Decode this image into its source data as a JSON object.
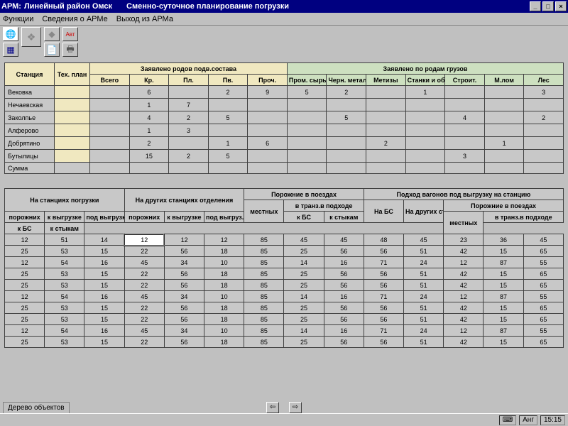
{
  "titlebar": {
    "app": "АРМ:",
    "region": "Линейный район Омск",
    "subtitle": "Сменно-суточное планирование погрузки"
  },
  "menu": {
    "functions": "Функции",
    "about": "Сведения о АРМе",
    "exit": "Выход из АРМа"
  },
  "table1": {
    "h_station": "Станция",
    "h_plan": "Тех. план",
    "h_declared_types": "Заявлено родов подв.состава",
    "h_declared_cargo": "Заявлено по родам грузов",
    "h_total": "Всего",
    "h_kr": "Кр.",
    "h_pl": "Пл.",
    "h_pv": "Пв.",
    "h_other": "Проч.",
    "h_prom": "Пром. сырье",
    "h_chern": "Черн. металл.",
    "h_metiz": "Метизы",
    "h_stanki": "Станки и оборуд.",
    "h_stroit": "Строит.",
    "h_mlom": "М.лом",
    "h_les": "Лес",
    "rows": [
      {
        "st": "Вековка",
        "kr": "6",
        "pv": "2",
        "proch": "9",
        "prom": "5",
        "chern": "2",
        "stanki": "1",
        "les": "3"
      },
      {
        "st": "Нечаевская",
        "kr": "1",
        "pl": "7"
      },
      {
        "st": "Заколпье",
        "kr": "4",
        "pl": "2",
        "pv": "5",
        "chern": "5",
        "stroit": "4",
        "les": "2"
      },
      {
        "st": "Алферово",
        "kr": "1",
        "pl": "3"
      },
      {
        "st": "Добрятино",
        "kr": "2",
        "pv": "1",
        "proch": "6",
        "metiz": "2",
        "mlom": "1"
      },
      {
        "st": "Бутылицы",
        "kr": "15",
        "pl": "2",
        "pv": "5",
        "stroit": "3"
      }
    ],
    "sum_label": "Сумма"
  },
  "table2": {
    "h_loading": "На станциях погрузки",
    "h_other_st": "На других станциях отделения",
    "h_empty_trains": "Порожние в поездах",
    "h_approach": "Подход вагонов под выгрузку на станцию",
    "h_empty": "порожних",
    "h_unload": "к выгрузке",
    "h_under_unload": "под выгрузкой",
    "h_under_unload2": "под выгруз.",
    "h_local": "местных",
    "h_transit": "в транз.в подходе",
    "h_kbs": "к БС",
    "h_kstykam": "к стыкам",
    "h_nabs": "На БС",
    "h_other_nod": "На других ст. НОД",
    "h_empty2": "Порожние в поездах",
    "h_transit2": "в транз.в подходе",
    "rows": [
      [
        12,
        51,
        14,
        12,
        12,
        12,
        85,
        45,
        45,
        48,
        45,
        23,
        36,
        45
      ],
      [
        25,
        53,
        15,
        22,
        56,
        18,
        85,
        25,
        56,
        56,
        51,
        42,
        15,
        65
      ],
      [
        12,
        54,
        16,
        45,
        34,
        10,
        85,
        14,
        16,
        71,
        24,
        12,
        87,
        55
      ],
      [
        25,
        53,
        15,
        22,
        56,
        18,
        85,
        25,
        56,
        56,
        51,
        42,
        15,
        65
      ],
      [
        25,
        53,
        15,
        22,
        56,
        18,
        85,
        25,
        56,
        56,
        51,
        42,
        15,
        65
      ],
      [
        12,
        54,
        16,
        45,
        34,
        10,
        85,
        14,
        16,
        71,
        24,
        12,
        87,
        55
      ],
      [
        25,
        53,
        15,
        22,
        56,
        18,
        85,
        25,
        56,
        56,
        51,
        42,
        15,
        65
      ],
      [
        25,
        53,
        15,
        22,
        56,
        18,
        85,
        25,
        56,
        56,
        51,
        42,
        15,
        65
      ],
      [
        12,
        54,
        16,
        45,
        34,
        10,
        85,
        14,
        16,
        71,
        24,
        12,
        87,
        55
      ],
      [
        25,
        53,
        15,
        22,
        56,
        18,
        85,
        25,
        56,
        56,
        51,
        42,
        15,
        65
      ]
    ]
  },
  "tabs": {
    "tree": "Дерево объектов"
  },
  "status": {
    "lang": "Анг",
    "time": "15:15"
  }
}
